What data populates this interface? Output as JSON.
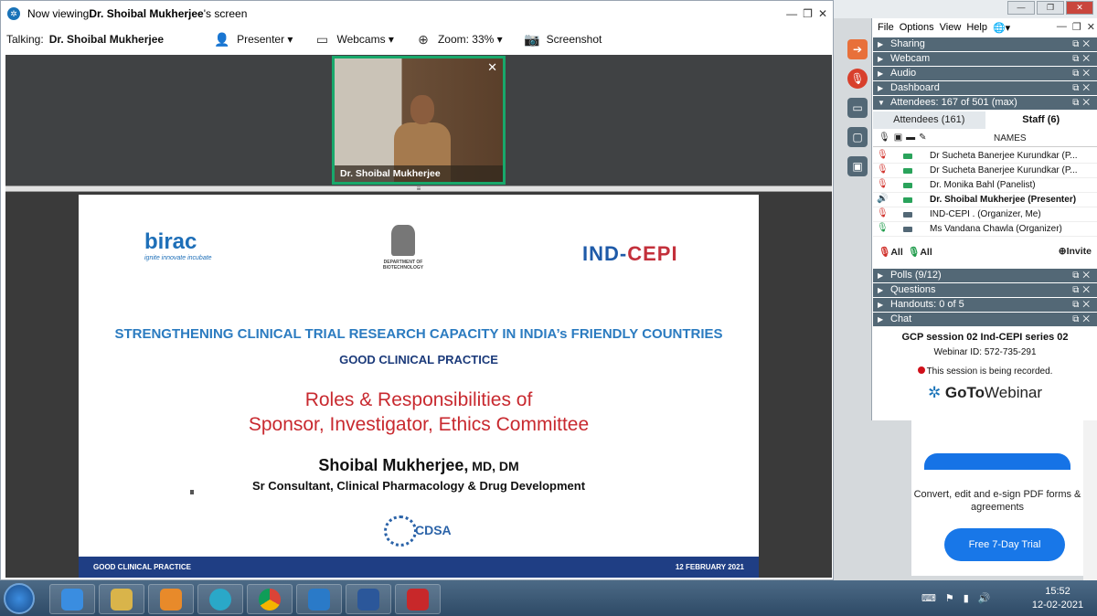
{
  "viewer": {
    "title_prefix": "Now viewing ",
    "title_name": "Dr. Shoibal Mukherjee",
    "title_suffix": "'s screen",
    "talking_label": "Talking:",
    "talking_name": "Dr. Shoibal Mukherjee",
    "presenter_label": "Presenter ▾",
    "webcams_label": "Webcams ▾",
    "zoom_label": "Zoom: 33% ▾",
    "screenshot_label": "Screenshot"
  },
  "webcam": {
    "name": "Dr. Shoibal Mukherjee",
    "close": "✕"
  },
  "slide": {
    "birac_logo": "birac",
    "birac_tagline": "ignite innovate incubate",
    "emblem_text": "DEPARTMENT OF BIOTECHNOLOGY",
    "indcepi_left": "IND-",
    "indcepi_right": "CEPI",
    "headline": "STRENGTHENING CLINICAL TRIAL RESEARCH CAPACITY IN INDIA’s FRIENDLY COUNTRIES",
    "subheadline": "GOOD CLINICAL PRACTICE",
    "topic_line1": "Roles & Responsibilities of",
    "topic_line2": "Sponsor, Investigator, Ethics Committee",
    "speaker": "Shoibal Mukherjee,",
    "speaker_degree": " MD, DM",
    "speaker_role": "Sr Consultant, Clinical Pharmacology & Drug Development",
    "cdsa": "CDSA",
    "footer_left": "GOOD CLINICAL PRACTICE",
    "footer_right": "12 FEBRUARY 2021"
  },
  "panel": {
    "menu": [
      "File",
      "Options",
      "View",
      "Help",
      "🌐▾"
    ],
    "sections": {
      "sharing": "Sharing",
      "webcam": "Webcam",
      "audio": "Audio",
      "dashboard": "Dashboard",
      "attendees": "Attendees:  167 of 501 (max)",
      "polls": "Polls (9/12)",
      "questions": "Questions",
      "handouts": "Handouts: 0 of 5",
      "chat": "Chat"
    },
    "tab_attendees": "Attendees (161)",
    "tab_staff": "Staff (6)",
    "names_header": "NAMES",
    "staff": [
      "Dr Sucheta Banerjee Kurundkar (P...",
      "Dr Sucheta Banerjee Kurundkar (P...",
      "Dr. Monika Bahl (Panelist)",
      "Dr. Shoibal Mukherjee (Presenter)",
      "IND-CEPI . (Organizer, Me)",
      "Ms Vandana Chawla (Organizer)"
    ],
    "mute_all": "All",
    "unmute_all": "All",
    "invite": "Invite",
    "session_title": "GCP session 02 Ind-CEPI series 02",
    "webinar_id": "Webinar ID: 572-735-291",
    "recording": "This session is being recorded.",
    "brand_goto": "GoTo",
    "brand_webinar": "Webinar"
  },
  "ad": {
    "text": "Convert, edit and e-sign PDF forms & agreements",
    "button": "Free 7-Day Trial"
  },
  "clock": {
    "time": "15:52",
    "date": "12-02-2021"
  },
  "colors": {
    "section_header": "#536876",
    "presenter_border": "#18a86b",
    "slide_footer": "#1f3e84",
    "headline": "#2b7bc0",
    "topic": "#c8292f"
  }
}
